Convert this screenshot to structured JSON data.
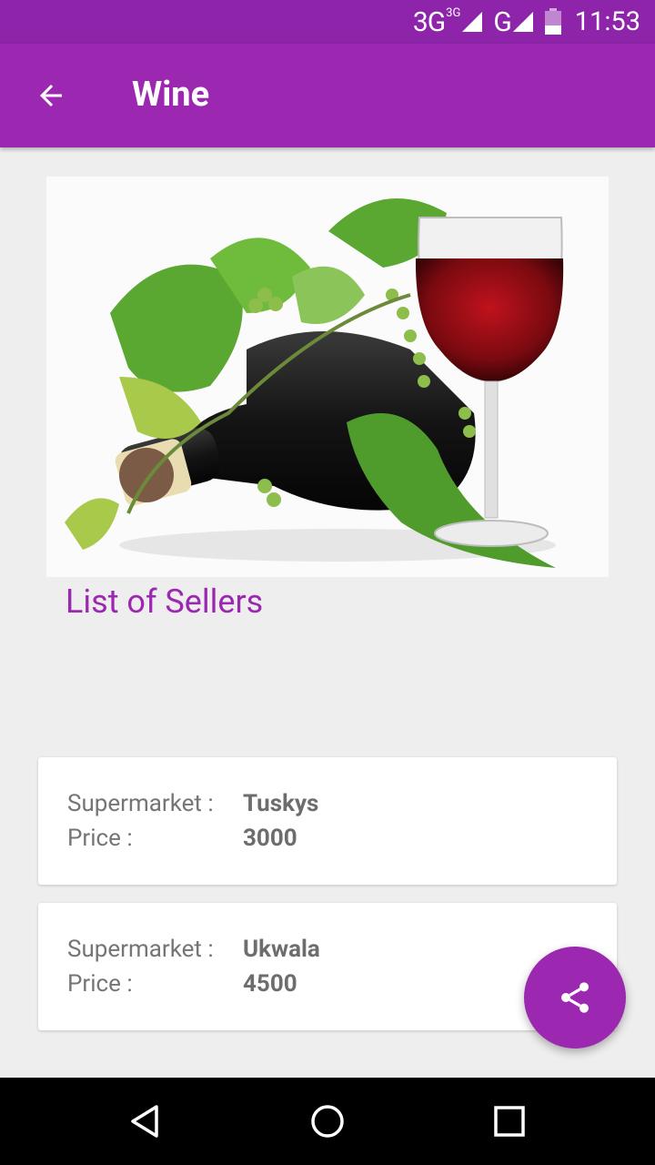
{
  "status_bar": {
    "network_1": "3G",
    "network_1_sup": "3G",
    "network_2": "G",
    "time": "11:53"
  },
  "app_bar": {
    "title": "Wine",
    "back_icon": "arrow-back-icon"
  },
  "hero_image": {
    "subject": "wine-bottle-glass-grapes-image"
  },
  "section_title": "List of Sellers",
  "sellers": [
    {
      "supermarket_label": "Supermarket :",
      "supermarket": "Tuskys",
      "price_label": "Price :",
      "price": "3000"
    },
    {
      "supermarket_label": "Supermarket :",
      "supermarket": "Ukwala",
      "price_label": "Price :",
      "price": "4500"
    }
  ],
  "fab": {
    "icon": "share-icon"
  },
  "nav_bar": {
    "back_icon": "nav-back-icon",
    "home_icon": "nav-home-icon",
    "recents_icon": "nav-recents-icon"
  },
  "colors": {
    "primary": "#9c27b0",
    "primary_dark": "#8e24aa",
    "background": "#eeeeee"
  }
}
